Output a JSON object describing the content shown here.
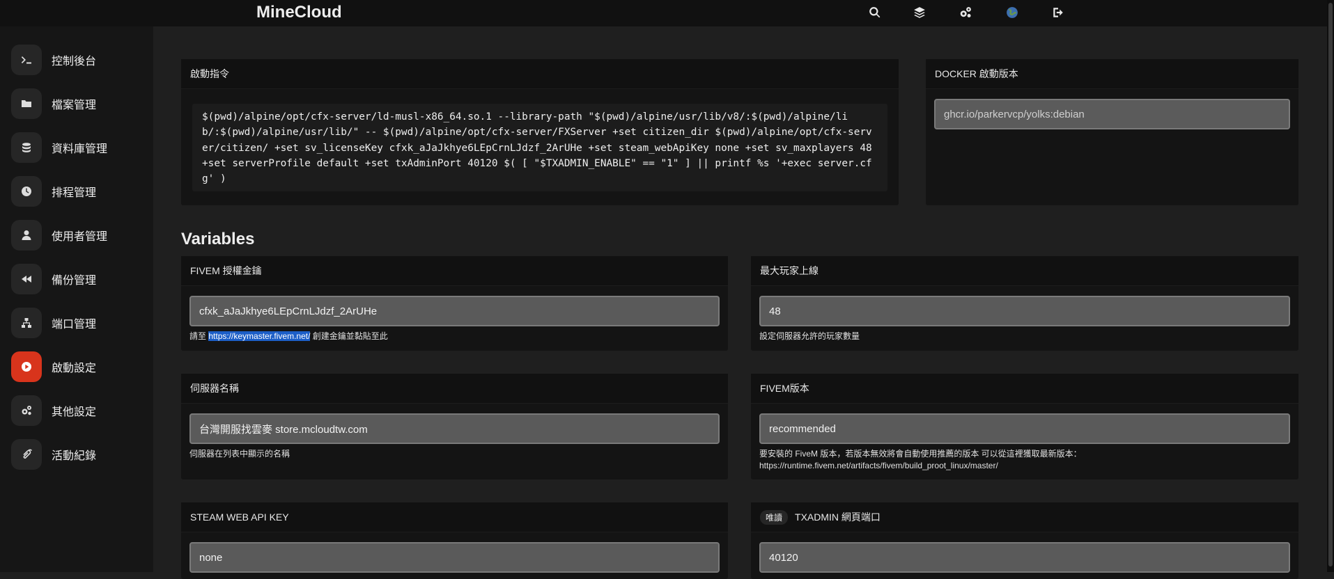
{
  "app": {
    "brand": "MineCloud"
  },
  "topbar": {
    "icons": [
      "search-icon",
      "layers-icon",
      "cogs-icon",
      "globe-icon",
      "sign-out-icon"
    ]
  },
  "sidebar": {
    "items": [
      {
        "label": "控制後台",
        "icon": "terminal-icon",
        "active": false
      },
      {
        "label": "檔案管理",
        "icon": "folder-icon",
        "active": false
      },
      {
        "label": "資料庫管理",
        "icon": "database-icon",
        "active": false
      },
      {
        "label": "排程管理",
        "icon": "clock-icon",
        "active": false
      },
      {
        "label": "使用者管理",
        "icon": "user-icon",
        "active": false
      },
      {
        "label": "備份管理",
        "icon": "backward-icon",
        "active": false
      },
      {
        "label": "端口管理",
        "icon": "network-icon",
        "active": false
      },
      {
        "label": "啟動設定",
        "icon": "play-circle-icon",
        "active": true
      },
      {
        "label": "其他設定",
        "icon": "cogs-icon",
        "active": false
      },
      {
        "label": "活動紀錄",
        "icon": "paperclip-icon",
        "active": false
      }
    ],
    "active_color": "#d8341c"
  },
  "startup": {
    "title": "啟動指令",
    "command": "$(pwd)/alpine/opt/cfx-server/ld-musl-x86_64.so.1 --library-path \"$(pwd)/alpine/usr/lib/v8/:$(pwd)/alpine/lib/:$(pwd)/alpine/usr/lib/\" -- $(pwd)/alpine/opt/cfx-server/FXServer +set citizen_dir $(pwd)/alpine/opt/cfx-server/citizen/ +set sv_licenseKey cfxk_aJaJkhye6LEpCrnLJdzf_2ArUHe +set steam_webApiKey none +set sv_maxplayers 48 +set serverProfile default +set txAdminPort 40120 $( [ \"$TXADMIN_ENABLE\" == \"1\" ] || printf %s '+exec server.cfg' )"
  },
  "docker": {
    "title": "DOCKER 啟動版本",
    "value": "ghcr.io/parkervcp/yolks:debian"
  },
  "variables": {
    "heading": "Variables",
    "license": {
      "title": "FIVEM 授權金鑰",
      "value": "cfxk_aJaJkhye6LEpCrnLJdzf_2ArUHe",
      "help_prefix": "請至",
      "help_link": "https://keymaster.fivem.net/",
      "help_suffix": "創建金鑰並黏貼至此"
    },
    "max_players": {
      "title": "最大玩家上線",
      "value": "48",
      "help": "設定伺服器允許的玩家數量"
    },
    "server_name": {
      "title": "伺服器名稱",
      "value": "台灣開服找雲麥 store.mcloudtw.com",
      "help": "伺服器在列表中顯示的名稱"
    },
    "fivem_version": {
      "title": "FIVEM版本",
      "value": "recommended",
      "help_line1": "要安裝的 FiveM 版本，若版本無效將會自動使用推薦的版本 可以從這裡獲取最新版本：",
      "help_line2": "https://runtime.fivem.net/artifacts/fivem/build_proot_linux/master/"
    },
    "steam_key": {
      "title": "STEAM WEB API KEY",
      "value": "none"
    },
    "txadmin_port": {
      "badge": "唯讀",
      "title": "TXADMIN 網頁端口",
      "value": "40120"
    }
  }
}
